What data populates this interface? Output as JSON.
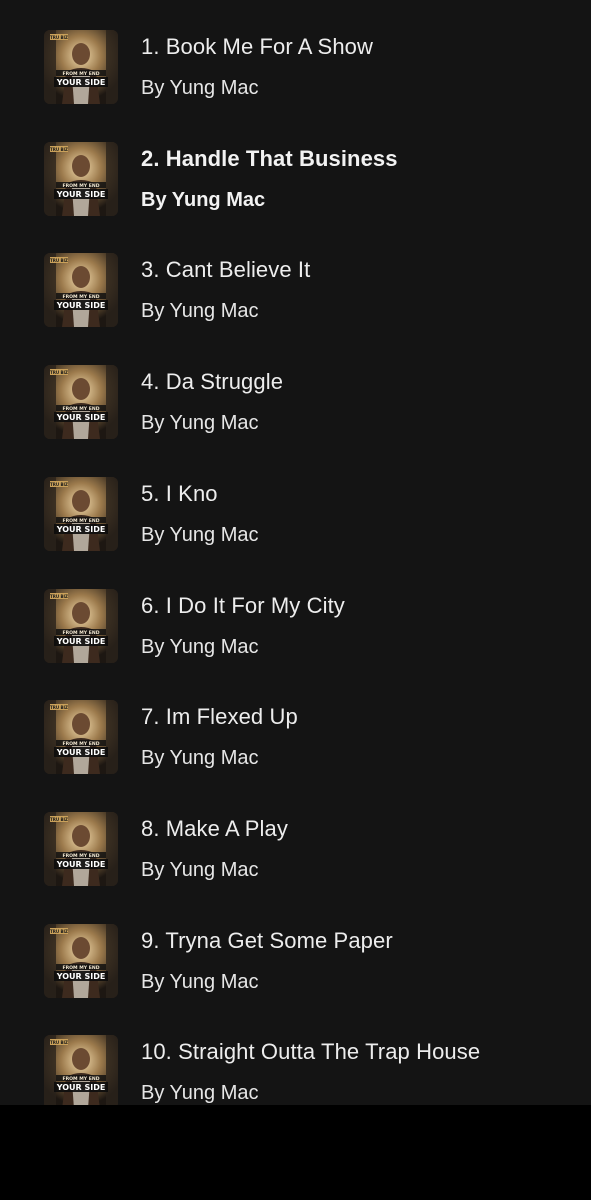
{
  "tracks": [
    {
      "title": "1. Book Me For A Show",
      "artist": "By Yung Mac",
      "active": false
    },
    {
      "title": "2. Handle That Business",
      "artist": "By Yung Mac",
      "active": true
    },
    {
      "title": "3. Cant Believe It",
      "artist": "By Yung Mac",
      "active": false
    },
    {
      "title": "4. Da Struggle",
      "artist": "By Yung Mac",
      "active": false
    },
    {
      "title": "5. I Kno",
      "artist": "By Yung Mac",
      "active": false
    },
    {
      "title": "6. I Do It For My City",
      "artist": "By Yung Mac",
      "active": false
    },
    {
      "title": "7. Im Flexed Up",
      "artist": "By Yung Mac",
      "active": false
    },
    {
      "title": "8. Make A Play",
      "artist": "By Yung Mac",
      "active": false
    },
    {
      "title": "9. Tryna Get Some Paper",
      "artist": "By Yung Mac",
      "active": false
    },
    {
      "title": "10. Straight Outta The Trap House",
      "artist": "By Yung Mac",
      "active": false
    }
  ],
  "cover_art": {
    "top_text": "TRU BIZ",
    "middle_text": "FROM MY END",
    "bottom_text": "YOUR SIDE"
  }
}
